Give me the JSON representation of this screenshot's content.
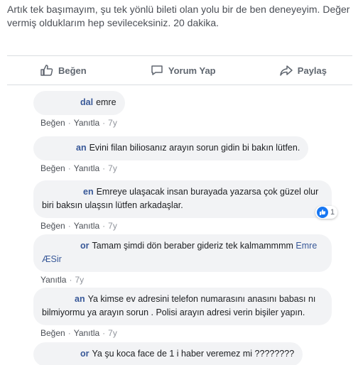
{
  "post": {
    "text": "Artık tek başımayım, şu tek yönlü bileti olan yolu bir de ben deneyeyim. Değer vermiş olduklarım hep sevileceksiniz. 20 dakika."
  },
  "actions": {
    "like_label": "Beğen",
    "comment_label": "Yorum Yap",
    "share_label": "Paylaş"
  },
  "meta_labels": {
    "like": "Beğen",
    "reply": "Yanıtla",
    "separator": "·"
  },
  "comments": [
    {
      "author": "dal",
      "text": "emre",
      "time": "7y",
      "has_like": true
    },
    {
      "author": "an",
      "text": "Evini filan biliosanız arayın sorun gidin bi bakın lütfen.",
      "time": "7y",
      "has_like": true
    },
    {
      "author": "en",
      "text": "Emreye ulaşacak insan burayada yazarsa çok güzel olur biri baksın ulaşsın lütfen arkadaşlar.",
      "time": "7y",
      "has_like": true,
      "reaction_count": "1"
    },
    {
      "author": "or",
      "text": "Tamam şimdi dön beraber gideriz tek kalmammmm",
      "mention": "Emre ÆSir",
      "time": "7y",
      "has_like": false
    },
    {
      "author": "an",
      "text": "Ya kimse ev adresini telefon numarasını anasını babası nı bilmiyormu ya arayın sorun . Polisi arayın adresi verin bişiler yapın.",
      "time": "7y",
      "has_like": true
    },
    {
      "author": "or",
      "text": "Ya şu koca face de 1 i haber veremez mi ????????"
    }
  ],
  "colors": {
    "link": "#385898",
    "bubble": "#f2f3f5",
    "like_blue": "#1877f2"
  }
}
